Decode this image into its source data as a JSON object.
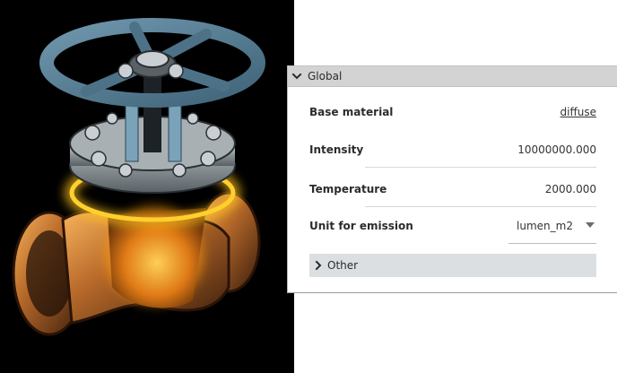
{
  "viewport": {
    "icon": "valve-render",
    "glow_color": "#ffb000"
  },
  "panel": {
    "section": {
      "title": "Global",
      "icon": "chevron-down-icon"
    },
    "rows": {
      "base_material": {
        "label": "Base material",
        "value": "diffuse"
      },
      "intensity": {
        "label": "Intensity",
        "value": "10000000.000"
      },
      "temperature": {
        "label": "Temperature",
        "value": "2000.000"
      },
      "unit_for_emission": {
        "label": "Unit for emission",
        "value": "lumen_m2"
      }
    },
    "subsection": {
      "title": "Other",
      "icon": "chevron-right-icon"
    }
  }
}
